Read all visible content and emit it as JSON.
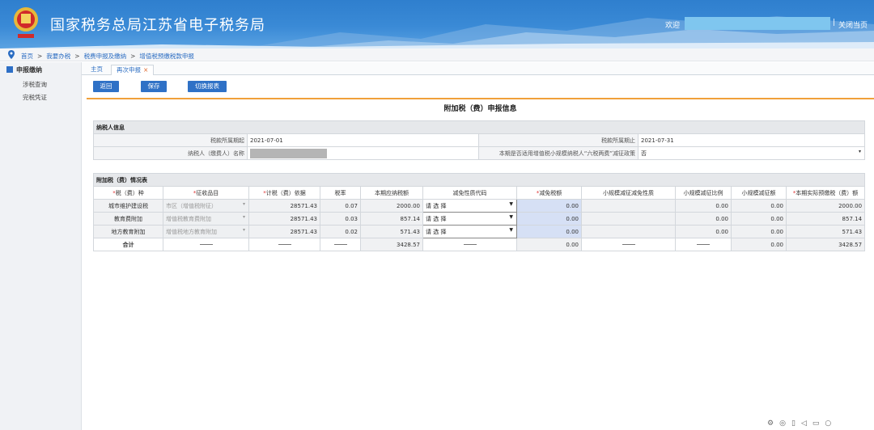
{
  "header": {
    "site_title": "国家税务总局江苏省电子税务局",
    "welcome": "欢迎",
    "close_page": "关闭当页",
    "separator": "|"
  },
  "breadcrumb": [
    "首页",
    "我要办税",
    "税费申报及缴纳",
    "增值税预缴税款申报"
  ],
  "sidebar": {
    "heading": "申报缴纳",
    "items": [
      "涉税查询",
      "完税凭证"
    ]
  },
  "tabs": [
    {
      "label": "主页"
    },
    {
      "label": "再次申报",
      "close": "×"
    }
  ],
  "toolbar": {
    "back": "返回",
    "save": "保存",
    "switch": "切换报表"
  },
  "form_title": "附加税（费）申报信息",
  "taxpayer": {
    "section_title": "纳税人信息",
    "period_start_label": "税款所属期起",
    "period_start": "2021-07-01",
    "period_end_label": "税款所属期止",
    "period_end": "2021-07-31",
    "name_label": "纳税人（缴费人）名称",
    "policy_label": "本期是否适用增值税小规模纳税人“六税两费”减征政策",
    "policy_value": "否"
  },
  "surtax": {
    "section_title": "附加税（费）情况表",
    "headers": [
      "税（费）种",
      "征收品目",
      "计税（费）依据",
      "税率",
      "本期应纳税额",
      "减免性质代码",
      "减免税额",
      "小规模减征减免性质",
      "小规模减征比例",
      "小规模减征额",
      "本期实际预缴税（费）额"
    ],
    "required_mark": "*",
    "rows": [
      {
        "type": "城市维护建设税",
        "item": "市区（增值税附征）",
        "basis": "28571.43",
        "rate": "0.07",
        "payable": "2000.00",
        "code": "请 选 择",
        "relief": "0.00",
        "ratio": "0.00",
        "reduction": "0.00",
        "actual": "2000.00"
      },
      {
        "type": "教育费附加",
        "item": "增值税教育费附加",
        "basis": "28571.43",
        "rate": "0.03",
        "payable": "857.14",
        "code": "请 选 择",
        "relief": "0.00",
        "ratio": "0.00",
        "reduction": "0.00",
        "actual": "857.14"
      },
      {
        "type": "地方教育附加",
        "item": "增值税地方教育附加",
        "basis": "28571.43",
        "rate": "0.02",
        "payable": "571.43",
        "code": "请 选 择",
        "relief": "0.00",
        "ratio": "0.00",
        "reduction": "0.00",
        "actual": "571.43"
      }
    ],
    "total": {
      "label": "合计",
      "payable": "3428.57",
      "relief": "0.00",
      "reduction": "0.00",
      "actual": "3428.57"
    }
  },
  "caret": "▾",
  "select_caret": "▼"
}
